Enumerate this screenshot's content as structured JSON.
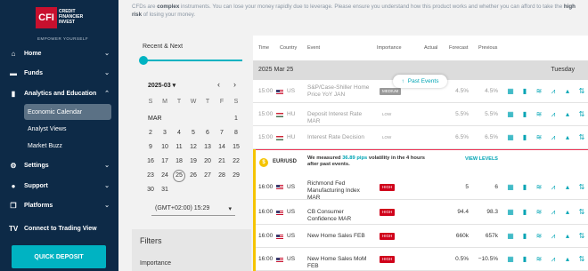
{
  "brand": {
    "logo_mark": "CFI",
    "logo_name": "CREDIT FINANCIER INVEST",
    "tagline": "EMPOWER YOURSELF"
  },
  "sidebar": {
    "items": [
      {
        "label": "Home",
        "icon": "home-icon",
        "glyph": "⌂",
        "chev": "⌄"
      },
      {
        "label": "Funds",
        "icon": "wallet-icon",
        "glyph": "▬",
        "chev": "⌄"
      },
      {
        "label": "Analytics and Education",
        "icon": "chart-icon",
        "glyph": "▮",
        "chev": "⌃"
      },
      {
        "label": "Settings",
        "icon": "gear-icon",
        "glyph": "⚙",
        "chev": "⌄"
      },
      {
        "label": "Support",
        "icon": "chat-icon",
        "glyph": "●",
        "chev": "⌄"
      },
      {
        "label": "Platforms",
        "icon": "platforms-icon",
        "glyph": "❐",
        "chev": "⌄"
      },
      {
        "label": "Connect to Trading View",
        "icon": "tradingview-icon",
        "glyph": "TV",
        "chev": ""
      }
    ],
    "sub_items": [
      "Economic Calendar",
      "Analyst Views",
      "Market Buzz"
    ],
    "deposit_label": "QUICK DEPOSIT"
  },
  "warning": {
    "part1": "CFDs are ",
    "bold1": "complex",
    "part2": " instruments. You can lose your money rapidly due to leverage. Please ensure you understand how this product works and whether you can afford to take the ",
    "bold2": "high risk",
    "part3": " of losing your money."
  },
  "calendar": {
    "title": "Recent & Next",
    "month": "2025-03",
    "prev": "‹",
    "next": "›",
    "weekdays": [
      "S",
      "M",
      "T",
      "W",
      "T",
      "F",
      "S"
    ],
    "month_tag": "MAR",
    "days": [
      "1",
      "2",
      "3",
      "4",
      "5",
      "6",
      "7",
      "8",
      "9",
      "10",
      "11",
      "12",
      "13",
      "14",
      "15",
      "16",
      "17",
      "18",
      "19",
      "20",
      "21",
      "22",
      "23",
      "24",
      "25",
      "26",
      "27",
      "28",
      "29",
      "30",
      "31"
    ],
    "today": "25",
    "timezone": "(GMT+02:00) 15:29"
  },
  "filters": {
    "title": "Filters",
    "importance_label": "Importance"
  },
  "table": {
    "headers": {
      "time": "Time",
      "country": "Country",
      "event": "Event",
      "importance": "Importance",
      "actual": "Actual",
      "forecast": "Forecast",
      "previous": "Previous"
    },
    "date": "2025 Mar 25",
    "weekday": "Tuesday",
    "past_events_label": "Past Events",
    "past_rows": [
      {
        "time": "15:00",
        "country": "US",
        "flag": "us",
        "event": "S&P/Case-Shiller Home Price YoY JAN",
        "importance": "MEDIUM",
        "level": "medium",
        "actual": "",
        "forecast": "4.5%",
        "previous": "4.5%"
      },
      {
        "time": "15:00",
        "country": "HU",
        "flag": "hu",
        "event": "Deposit Interest Rate MAR",
        "importance": "LOW",
        "level": "low",
        "actual": "",
        "forecast": "5.5%",
        "previous": "5.5%"
      },
      {
        "time": "15:00",
        "country": "HU",
        "flag": "hu",
        "event": "Interest Rate Decision",
        "importance": "LOW",
        "level": "low",
        "actual": "",
        "forecast": "6.5%",
        "previous": "6.5%"
      }
    ],
    "volatility": {
      "pair": "EUR/USD",
      "text_pre": "We measured ",
      "pips": "36.89 pips",
      "text_post": " volatility in the 4 hours after past events.",
      "link": "VIEW LEVELS"
    },
    "upcoming_rows": [
      {
        "time": "16:00",
        "country": "US",
        "flag": "us",
        "event": "Richmond Fed Manufacturing Index MAR",
        "importance": "HIGH",
        "level": "high",
        "actual": "",
        "forecast": "5",
        "previous": "6"
      },
      {
        "time": "16:00",
        "country": "US",
        "flag": "us",
        "event": "CB Consumer Confidence MAR",
        "importance": "HIGH",
        "level": "high",
        "actual": "",
        "forecast": "94.4",
        "previous": "98.3"
      },
      {
        "time": "16:00",
        "country": "US",
        "flag": "us",
        "event": "New Home Sales FEB",
        "importance": "HIGH",
        "level": "high",
        "actual": "",
        "forecast": "660k",
        "previous": "657k"
      },
      {
        "time": "16:00",
        "country": "US",
        "flag": "us",
        "event": "New Home Sales MoM FEB",
        "importance": "HIGH",
        "level": "high",
        "actual": "",
        "forecast": "0.5%",
        "previous": "−10.5%"
      }
    ],
    "action_icons": [
      "calendar-icon",
      "bar-chart-icon",
      "wave-chart-icon",
      "trend-chart-icon",
      "growth-chart-icon",
      "sort-arrows-icon"
    ]
  }
}
